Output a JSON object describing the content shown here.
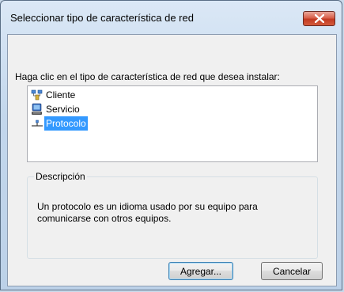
{
  "window": {
    "title": "Seleccionar tipo de característica de red"
  },
  "instruction": "Haga clic en el tipo de característica de red que desea instalar:",
  "list": {
    "items": [
      {
        "label": "Cliente",
        "icon": "network-client-icon",
        "selected": false
      },
      {
        "label": "Servicio",
        "icon": "network-service-icon",
        "selected": false
      },
      {
        "label": "Protocolo",
        "icon": "network-protocol-icon",
        "selected": true
      }
    ]
  },
  "description": {
    "title": "Descripción",
    "text": "Un protocolo es un idioma usado por su equipo para comunicarse con otros equipos."
  },
  "buttons": {
    "add_label": "Agregar...",
    "cancel_label": "Cancelar"
  },
  "colors": {
    "selection": "#3399ff",
    "close_button": "#c23a22"
  }
}
